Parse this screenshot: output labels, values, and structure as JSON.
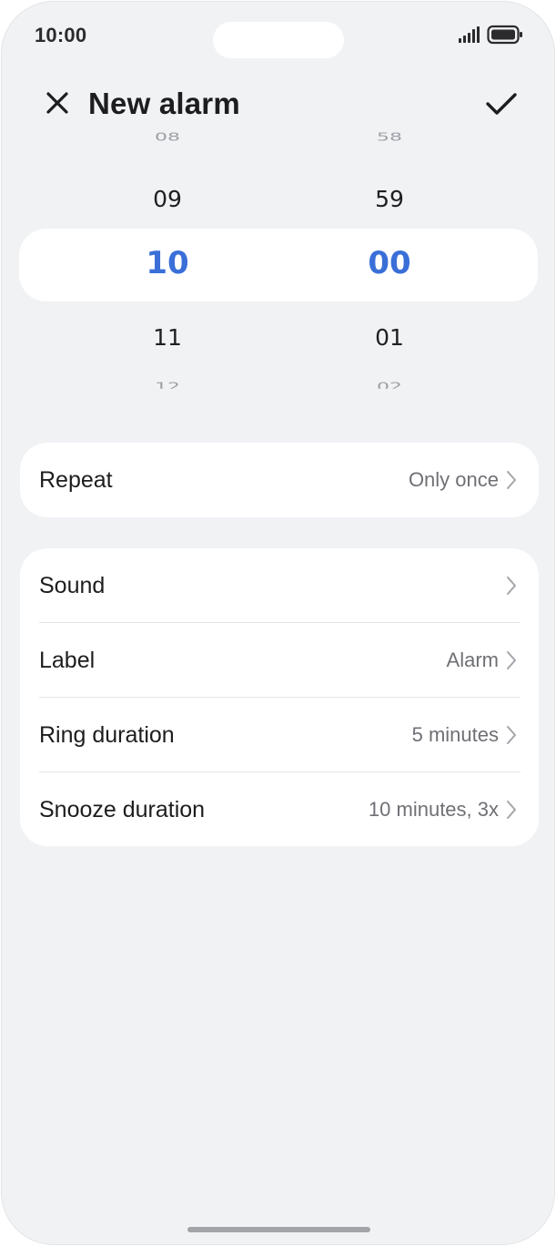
{
  "status_bar": {
    "time": "10:00",
    "signal_icon": "signal-icon",
    "battery_icon": "battery-icon"
  },
  "header": {
    "close_icon": "close-icon",
    "title": "New alarm",
    "confirm_icon": "check-icon"
  },
  "picker": {
    "hours": {
      "faint_above": "08",
      "prev": "09",
      "selected": "10",
      "next": "11",
      "faint_below": "12"
    },
    "minutes": {
      "faint_above": "58",
      "prev": "59",
      "selected": "00",
      "next": "01",
      "faint_below": "02"
    },
    "selected_color": "#3a6fd8"
  },
  "repeat": {
    "label": "Repeat",
    "value": "Only once"
  },
  "settings": [
    {
      "label": "Sound",
      "value": ""
    },
    {
      "label": "Label",
      "value": "Alarm"
    },
    {
      "label": "Ring duration",
      "value": "5 minutes"
    },
    {
      "label": "Snooze duration",
      "value": "10 minutes, 3x"
    }
  ]
}
